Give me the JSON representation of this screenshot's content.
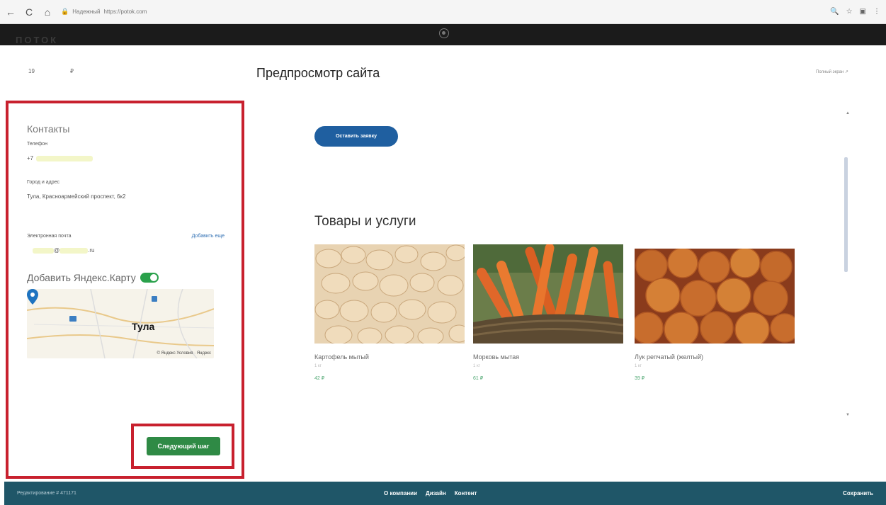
{
  "browser": {
    "back": "←",
    "reload": "C",
    "home": "⌂",
    "security": "Надежный",
    "url": "https://potok.com",
    "right_icons": [
      "🔍",
      "☆",
      "▣",
      "⋮"
    ]
  },
  "header": {
    "logo": "ПОТОК"
  },
  "left_top": {
    "item1": "19",
    "item2": "₽"
  },
  "contacts": {
    "title": "Контакты",
    "phone_label": "Телефон",
    "phone_value": "+7",
    "address_label": "Город и адрес",
    "address_value": "Тула, Красноармейский проспект, 6к2",
    "email_label": "Электронная почта",
    "email_add": "Добавить еще",
    "email_at": "@",
    "email_tld": ".ru",
    "yandex_label": "Добавить Яндекс.Карту",
    "yandex_enabled": true,
    "map_city": "Тула",
    "map_footer": "© Яндекс Условия · Яндекс",
    "next_button": "Следующий шаг"
  },
  "preview": {
    "title": "Предпросмотр сайта",
    "fullscreen": "Полный экран ↗",
    "cta_button": "Оставить заявку",
    "section_title": "Товары и услуги",
    "products": [
      {
        "name": "Картофель мытый",
        "sub": "1 кг",
        "price": "42 ₽",
        "icon": "potatoes-image"
      },
      {
        "name": "Морковь мытая",
        "sub": "1 кг",
        "price": "61 ₽",
        "icon": "carrots-image"
      },
      {
        "name": "Лук репчатый (желтый)",
        "sub": "1 кг",
        "price": "39 ₽",
        "icon": "onions-image"
      }
    ],
    "scroll_up": "▲",
    "scroll_down": "▼"
  },
  "bottom_bar": {
    "edit_label": "Редактирование # 471171",
    "nav": [
      "О компании",
      "Дизайн",
      "Контент"
    ],
    "save": "Сохранить"
  }
}
